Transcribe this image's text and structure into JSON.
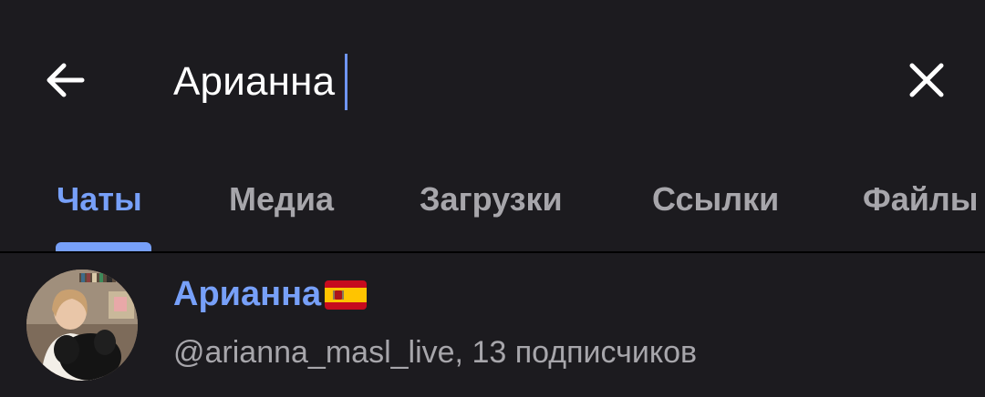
{
  "search": {
    "query": "Арианна",
    "back_icon": "arrow-left-icon",
    "clear_icon": "close-icon"
  },
  "tabs": [
    {
      "label": "Чаты",
      "active": true
    },
    {
      "label": "Медиа",
      "active": false
    },
    {
      "label": "Загрузки",
      "active": false
    },
    {
      "label": "Ссылки",
      "active": false
    },
    {
      "label": "Файлы",
      "active": false
    }
  ],
  "results": [
    {
      "name": "Арианна",
      "flag_icon": "spain-flag-icon",
      "subtitle": "@arianna_masl_live, 13 подписчиков"
    }
  ],
  "colors": {
    "background": "#1c1b1f",
    "accent": "#77a0f9",
    "caret": "#6f95f5",
    "muted_text": "#a7a6ab"
  }
}
